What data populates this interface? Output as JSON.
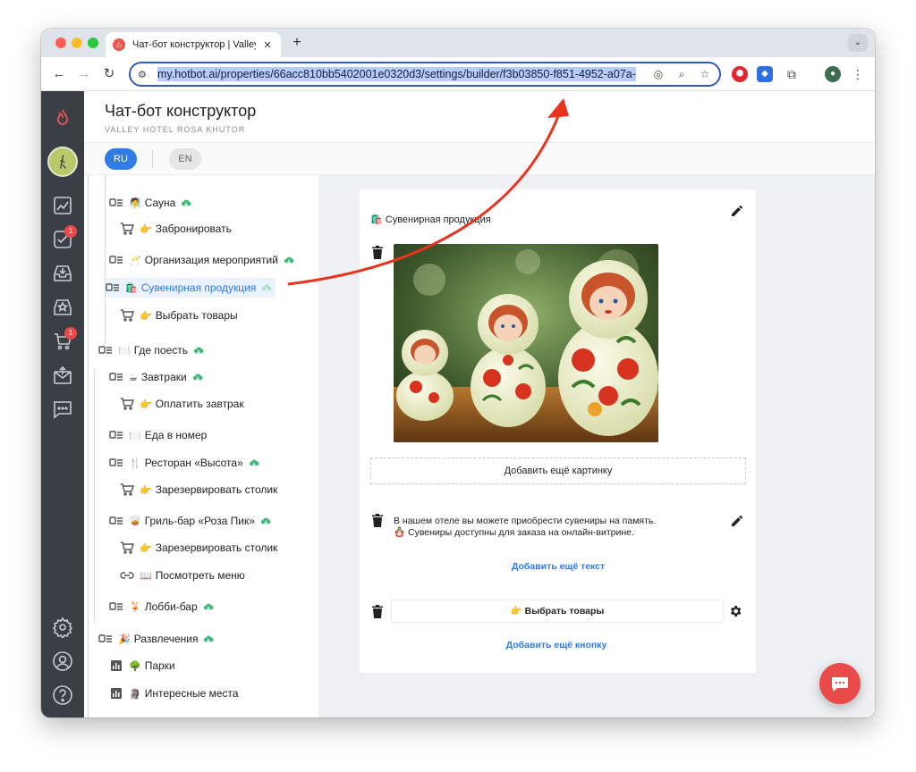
{
  "browser": {
    "tab_title": "Чат-бот конструктор | Valley",
    "tab_close": "✕",
    "new_tab": "+",
    "tab_menu": "⌄",
    "url": "my.hotbot.ai/properties/66acc810bb5402001e0320d3/settings/builder/f3b03850-f851-4952-a07a-"
  },
  "header": {
    "title": "Чат-бот конструктор",
    "subtitle": "VALLEY HOTEL ROSA KHUTOR"
  },
  "languages": {
    "ru": "RU",
    "en": "EN",
    "active": "RU"
  },
  "rail": {
    "badges": {
      "tasks": "1",
      "cart": "1"
    }
  },
  "tree": {
    "items": [
      {
        "label": "Сауна",
        "emoji": "🧖"
      },
      {
        "label": "Забронировать",
        "emoji": "👉"
      },
      {
        "label": "Организация мероприятий",
        "emoji": "🥂"
      },
      {
        "label": "Сувенирная продукция",
        "emoji": "🛍️"
      },
      {
        "label": "Выбрать товары",
        "emoji": "👉"
      },
      {
        "label": "Где поесть",
        "emoji": "🍽️"
      },
      {
        "label": "Завтраки",
        "emoji": "☕"
      },
      {
        "label": "Оплатить завтрак",
        "emoji": "👉"
      },
      {
        "label": "Еда в номер",
        "emoji": "🍽️"
      },
      {
        "label": "Ресторан «Высота»",
        "emoji": "🍴"
      },
      {
        "label": "Зарезервировать столик",
        "emoji": "👉"
      },
      {
        "label": "Гриль-бар «Роза Пик»",
        "emoji": "🥃"
      },
      {
        "label": "Зарезервировать столик",
        "emoji": "👉"
      },
      {
        "label": "Посмотреть меню",
        "emoji": "📖"
      },
      {
        "label": "Лобби-бар",
        "emoji": "🍹"
      },
      {
        "label": "Развлечения",
        "emoji": "🎉"
      },
      {
        "label": "Парки",
        "emoji": "🌳"
      },
      {
        "label": "Интересные места",
        "emoji": "🗿"
      }
    ]
  },
  "panel": {
    "title": "Сувенирная продукция",
    "title_emoji": "🛍️",
    "add_image": "Добавить ещё картинку",
    "text_line1": "В нашем отеле вы можете приобрести сувениры на память.",
    "text_line2": "🪆 Сувениры доступны для заказа на онлайн-витрине.",
    "add_text": "Добавить ещё текст",
    "button_label": "👉 Выбрать товары",
    "add_button": "Добавить ещё кнопку"
  },
  "colors": {
    "accent": "#2f7de1",
    "rail": "#3a3e45",
    "fab": "#ea4a4a",
    "annotation_arrow": "#e8331f"
  }
}
